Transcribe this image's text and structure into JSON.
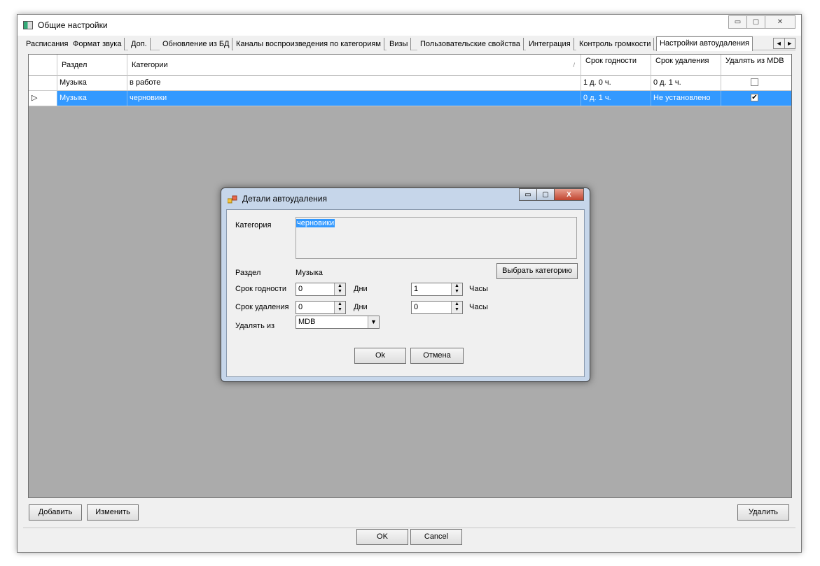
{
  "window": {
    "title": "Общие настройки",
    "minimize": "▭",
    "maximize": "▢",
    "close": "✕"
  },
  "tabs": [
    {
      "label": "Расписания",
      "active": false
    },
    {
      "label": "Формат звука",
      "active": false
    },
    {
      "label": "Доп.",
      "active": false
    },
    {
      "label": "Обновление из БД",
      "active": false
    },
    {
      "label": "Каналы воспроизведения по категориям",
      "active": false
    },
    {
      "label": "Визы",
      "active": false
    },
    {
      "label": "Пользовательские свойства",
      "active": false
    },
    {
      "label": "Интеграция",
      "active": false
    },
    {
      "label": "Контроль громкости",
      "active": false
    },
    {
      "label": "Настройки автоудаления",
      "active": true
    }
  ],
  "tab_scroll": {
    "left": "◄",
    "right": "►"
  },
  "grid": {
    "columns": [
      {
        "label": "Раздел"
      },
      {
        "label": "Категории",
        "sort_glyph": "/"
      },
      {
        "label": "Срок годности"
      },
      {
        "label": "Срок удаления"
      },
      {
        "label": "Удалять из MDB"
      }
    ],
    "rows": [
      {
        "section": "Музыка",
        "category": "в работе",
        "shelf": "1 д. 0 ч.",
        "delete_after": "0 д. 1 ч.",
        "delete_mdb": false,
        "selected": false
      },
      {
        "section": "Музыка",
        "category": "черновики",
        "shelf": "0 д. 1 ч.",
        "delete_after": "Не установлено",
        "delete_mdb": true,
        "selected": true
      }
    ],
    "row_marker": "▷"
  },
  "buttons": {
    "add": "Добавить",
    "edit": "Изменить",
    "delete": "Удалить",
    "ok": "OK",
    "cancel": "Cancel"
  },
  "dialog": {
    "title": "Детали автоудаления",
    "category_label": "Категория",
    "category_value": "черновики",
    "section_label": "Раздел",
    "section_value": "Музыка",
    "choose_category": "Выбрать категорию",
    "shelf_label": "Срок годности",
    "shelf_days": "0",
    "days_label": "Дни",
    "shelf_hours": "1",
    "hours_label": "Часы",
    "delete_label": "Срок удаления",
    "delete_days": "0",
    "delete_hours": "0",
    "delete_from_label": "Удалять из",
    "delete_from_value": "MDB",
    "ok": "Ok",
    "cancel": "Отмена",
    "close_glyph": "X"
  }
}
